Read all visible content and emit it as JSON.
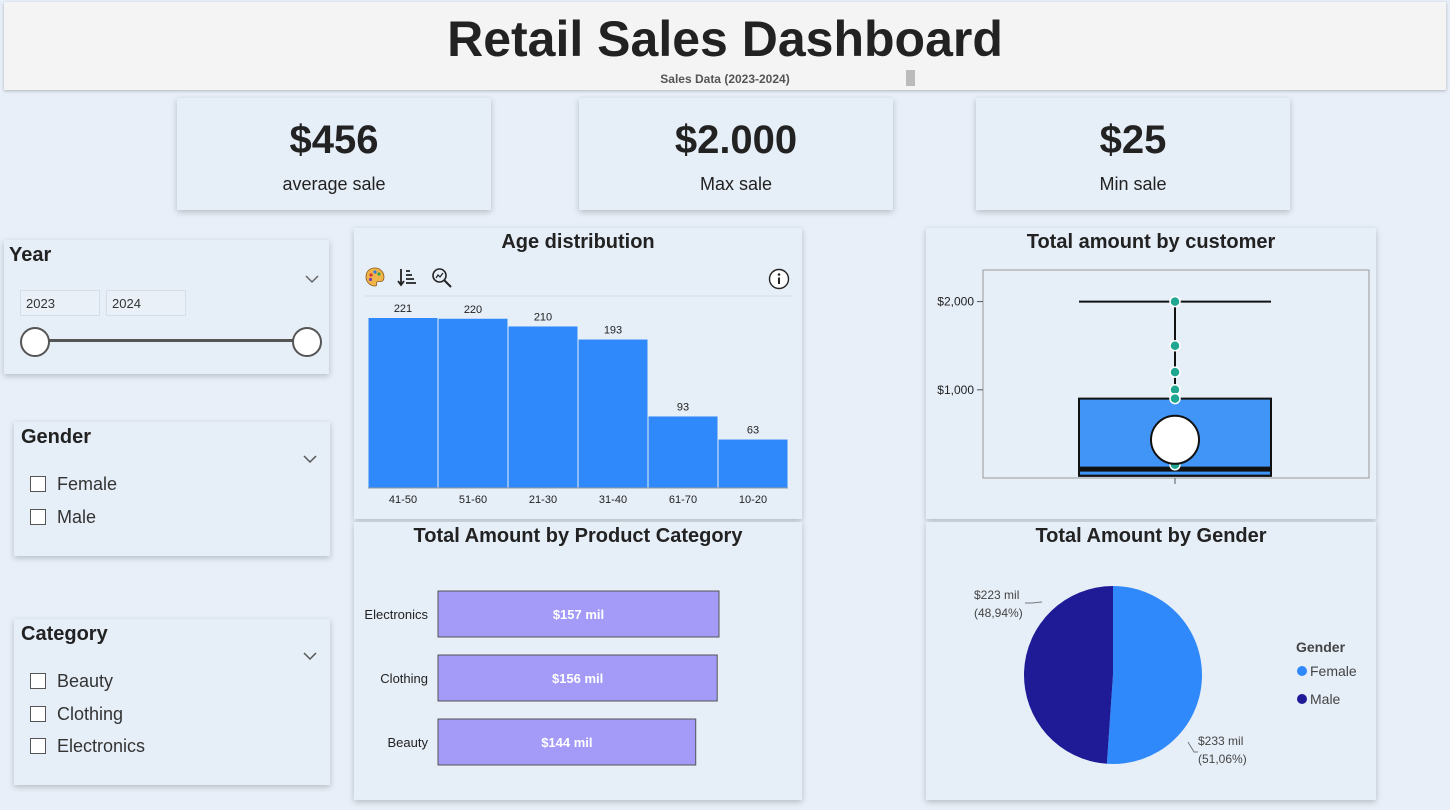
{
  "header": {
    "title": "Retail Sales Dashboard",
    "subtitle": "Sales Data (2023-2024)"
  },
  "kpis": [
    {
      "value": "$456",
      "label": "average sale"
    },
    {
      "value": "$2.000",
      "label": "Max sale"
    },
    {
      "value": "$25",
      "label": "Min sale"
    }
  ],
  "filters": {
    "year": {
      "title": "Year",
      "start": "2023",
      "end": "2024"
    },
    "gender": {
      "title": "Gender",
      "options": [
        "Female",
        "Male"
      ]
    },
    "category": {
      "title": "Category",
      "options": [
        "Beauty",
        "Clothing",
        "Electronics"
      ]
    }
  },
  "toolbar_icons": [
    "palette-icon",
    "sort-icon",
    "zoom-icon",
    "info-icon"
  ],
  "colors": {
    "bar_blue": "#3089fb",
    "bar_purple": "#a39bf7",
    "box_blue": "#4095f7",
    "dot_teal": "#1fa792",
    "pie_female": "#3089fb",
    "pie_male": "#1f1b96"
  },
  "chart_data": [
    {
      "type": "bar",
      "title": "Age distribution",
      "categories": [
        "41-50",
        "51-60",
        "21-30",
        "31-40",
        "61-70",
        "10-20"
      ],
      "values": [
        221,
        220,
        210,
        193,
        93,
        63
      ],
      "ylim": [
        0,
        230
      ]
    },
    {
      "type": "box",
      "title": "Total amount by customer",
      "y_ticks": [
        "$1,000",
        "$2,000"
      ],
      "y_tick_values": [
        1000,
        2000
      ],
      "ylim": [
        0,
        2400
      ],
      "box": {
        "min": 25,
        "q1": 60,
        "median": 100,
        "q3": 900,
        "max": 2000,
        "mean": 456
      },
      "outliers": [
        2000,
        1500,
        1200,
        1000,
        900,
        150
      ]
    },
    {
      "type": "bar",
      "orientation": "horizontal",
      "title": "Total Amount by Product Category",
      "categories": [
        "Electronics",
        "Clothing",
        "Beauty"
      ],
      "values": [
        157,
        156,
        144
      ],
      "labels": [
        "$157 mil",
        "$156 mil",
        "$144 mil"
      ]
    },
    {
      "type": "pie",
      "title": "Total Amount by Gender",
      "legend_title": "Gender",
      "legend_position": "right",
      "slices": [
        {
          "name": "Female",
          "value": 233,
          "percent": 51.06,
          "label": "$233 mil",
          "pct_label": "(51,06%)"
        },
        {
          "name": "Male",
          "value": 223,
          "percent": 48.94,
          "label": "$223 mil",
          "pct_label": "(48,94%)"
        }
      ]
    }
  ]
}
